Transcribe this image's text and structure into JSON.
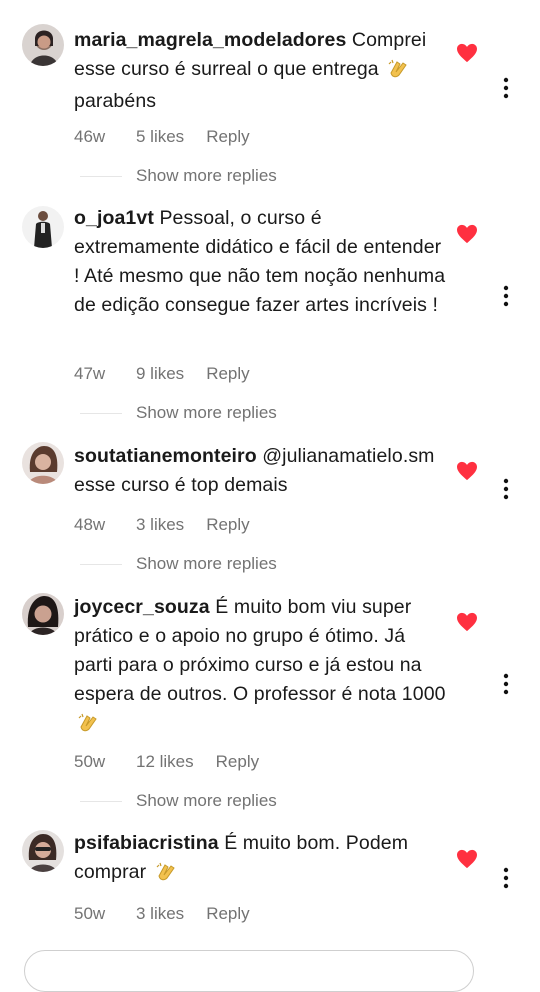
{
  "comments": [
    {
      "username": "maria_magrela_modeladores",
      "text": "Comprei esse curso é surreal o que entrega",
      "text_end": "parabéns",
      "time": "46w",
      "likes": "5 likes",
      "reply": "Reply",
      "more_replies": "Show more replies"
    },
    {
      "username": "o_joa1vt",
      "text": "Pessoal, o curso é extremamente didático e fácil de entender ! Até mesmo que não tem noção nenhuma de edição consegue fazer artes incríveis !",
      "time": "47w",
      "likes": "9 likes",
      "reply": "Reply",
      "more_replies": "Show more replies"
    },
    {
      "username": "soutatianemonteiro",
      "text": "@julianamatielo.sm esse curso é top demais",
      "time": "48w",
      "likes": "3 likes",
      "reply": "Reply",
      "more_replies": "Show more replies"
    },
    {
      "username": "joycecr_souza",
      "text": "É muito bom viu super prático e o apoio no grupo é ótimo. Já parti para o próximo curso e já estou na espera de outros. O professor é nota 1000",
      "time": "50w",
      "likes": "12 likes",
      "reply": "Reply",
      "more_replies": "Show more replies"
    },
    {
      "username": "psifabiacristina",
      "text": "É muito bom. Podem comprar",
      "time": "50w",
      "likes": "3 likes",
      "reply": "Reply"
    }
  ],
  "icons": {
    "like": "heart-icon",
    "options": "more-options-icon",
    "emoji": "clapping-hands-emoji"
  },
  "colors": {
    "heart": "#ff3040",
    "meta_text": "#737373",
    "primary_text": "#1a1a1a"
  }
}
